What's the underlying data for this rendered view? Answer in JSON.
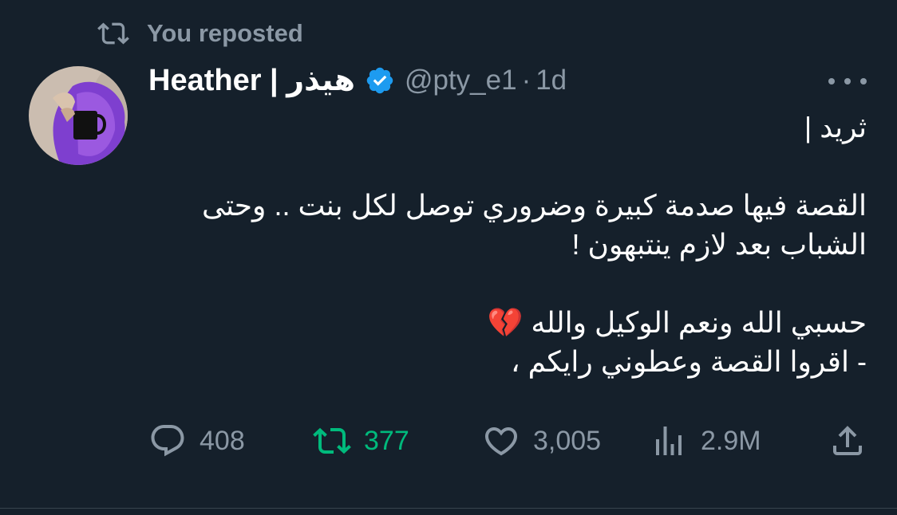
{
  "repost_banner": {
    "icon": "repost-icon",
    "text": "You reposted"
  },
  "author": {
    "display_name": "Heather | هيذر",
    "verified": true,
    "handle": "@pty_e1",
    "separator": "·",
    "time": "1d"
  },
  "tweet": {
    "lines": [
      "ثريد |",
      "",
      "القصة فيها صدمة كبيرة وضروري توصل لكل بنت .. وحتى الشباب بعد لازم ينتبهون !",
      "",
      "حسبي الله ونعم الوكيل والله 💔",
      "- اقروا القصة وعطوني رايكم ،"
    ]
  },
  "actions": {
    "replies": "408",
    "reposts": "377",
    "likes": "3,005",
    "views": "2.9M"
  },
  "colors": {
    "background": "#15202b",
    "muted": "#8b98a5",
    "repost_active": "#00ba7c",
    "verified_blue": "#1d9bf0"
  }
}
